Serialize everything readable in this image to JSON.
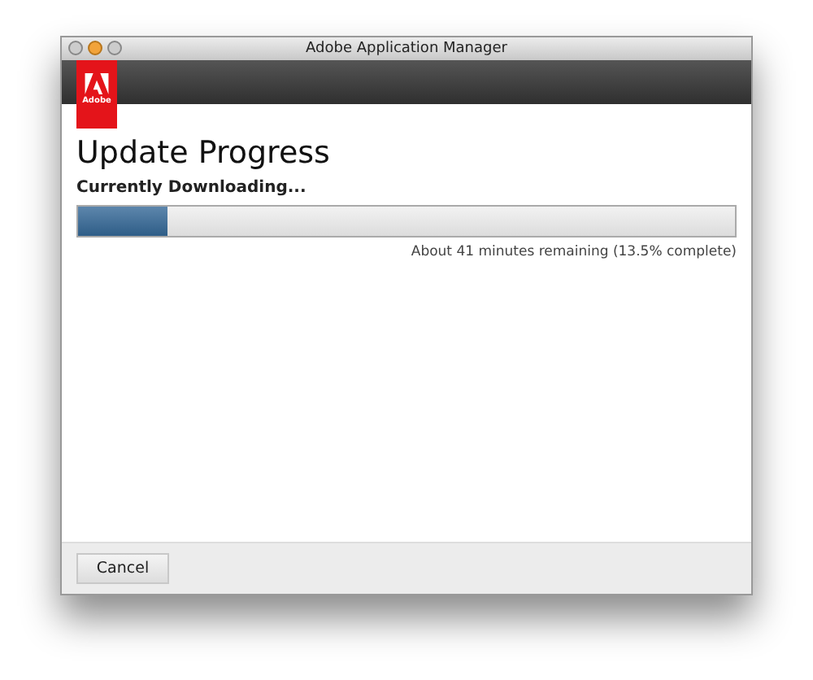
{
  "window": {
    "title": "Adobe Application Manager"
  },
  "logo": {
    "text": "Adobe"
  },
  "heading": "Update Progress",
  "status": "Currently Downloading...",
  "progress": {
    "level": 0.135,
    "reading": "About 41 minutes remaining (13.5% complete)"
  },
  "buttons": [
    "Cancel"
  ]
}
